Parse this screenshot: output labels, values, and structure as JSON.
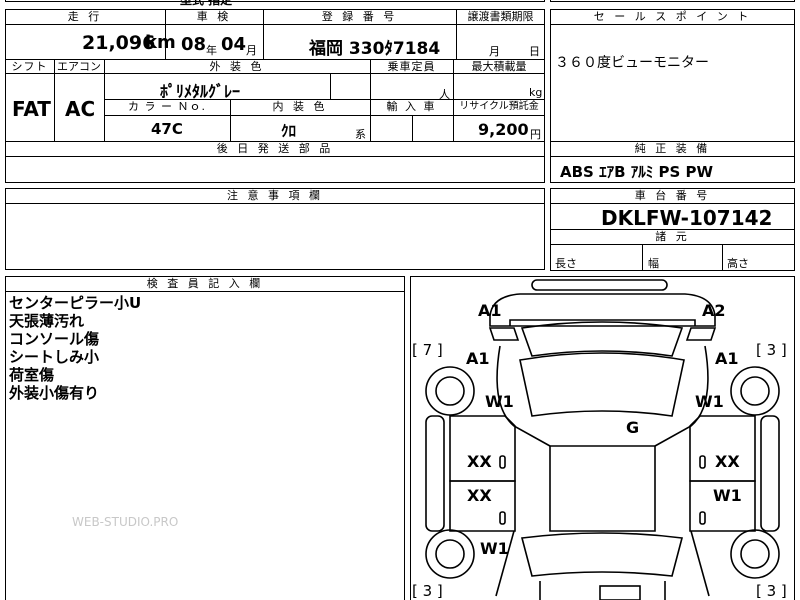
{
  "top_cut_text": "型式 指定",
  "vehicle": {
    "h_mileage": "走 行",
    "mileage": "21,096",
    "mileage_unit": "km",
    "h_inspection": "車 検",
    "insp_year": "08",
    "insp_year_unit": "年",
    "insp_month": "04",
    "insp_month_unit": "月",
    "h_registration": "登 録 番 号",
    "registration": "福岡 330ﾀ7184",
    "h_transfer": "譲渡書類期限",
    "transfer_month_unit": "月",
    "transfer_day_unit": "日",
    "h_shift": "シフト",
    "shift": "FAT",
    "h_aircon": "エアコン",
    "aircon": "AC",
    "h_exterior": "外 装 色",
    "exterior_color": "ﾎﾟﾘﾒﾀﾙｸﾞﾚｰ",
    "h_capacity": "乗車定員",
    "capacity_unit": "人",
    "h_max_load": "最大積載量",
    "max_load_unit": "kg",
    "h_color_no": "カ ラ ー Ｎｏ.",
    "color_no": "47C",
    "h_interior": "内 装 色",
    "interior_color": "ｸﾛ",
    "interior_suffix": "系",
    "h_import": "輸 入 車",
    "h_recycle": "リサイクル預託金",
    "recycle_fee": "9,200",
    "recycle_unit": "円",
    "h_later_parts": "後 日 発 送 部 品"
  },
  "sales_point": {
    "header": "セ ー ル ス ポ イ ン ト",
    "text": "３６０度ビューモニター"
  },
  "genuine_equipment": {
    "header": "純 正 装 備",
    "text": "ABS ｴｱB ｱﾙﾐ PS PW"
  },
  "notes": {
    "header": "注 意 事 項 欄"
  },
  "chassis": {
    "header": "車 台 番 号",
    "number": "DKLFW-107142"
  },
  "dimensions": {
    "header": "諸 元",
    "length_label": "長さ",
    "width_label": "幅",
    "height_label": "高さ"
  },
  "inspector": {
    "header": "検 査 員 記 入 欄",
    "lines": [
      "センターピラー小U",
      "天張薄汚れ",
      "コンソール傷",
      "シートしみ小",
      "荷室傷",
      "外装小傷有り"
    ]
  },
  "watermark": "WEB-STUDIO.PRO",
  "diagram": {
    "marks": {
      "a1_top": "A1",
      "a2_top": "A2",
      "a1_left": "A1",
      "a1_right": "A1",
      "w1_left_upper": "W1",
      "w1_right_upper": "W1",
      "g": "G",
      "xx_left_upper": "XX",
      "xx_right_upper": "XX",
      "xx_left_lower": "XX",
      "w1_right_lower": "W1",
      "w1_left_rear": "W1"
    },
    "tires": {
      "front_left": "[ 7 ]",
      "front_right": "[ 3 ]",
      "rear_left": "[ 3 ]",
      "rear_right": "[ 3 ]"
    }
  }
}
